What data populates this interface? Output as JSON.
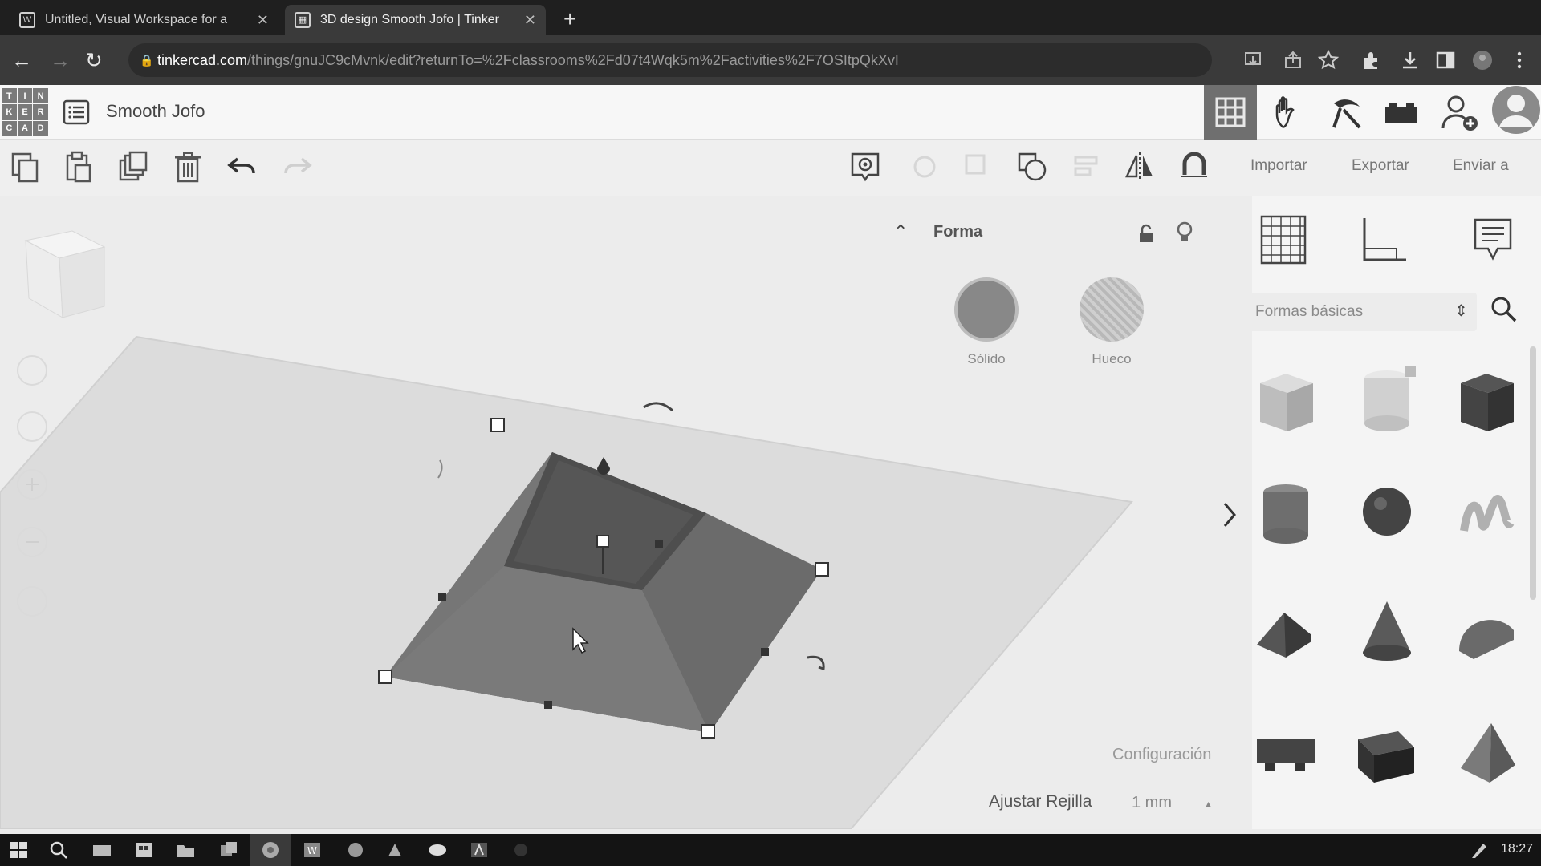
{
  "browser": {
    "tabs": [
      {
        "title": "Untitled, Visual Workspace for a",
        "active": false
      },
      {
        "title": "3D design Smooth Jofo | Tinker",
        "active": true
      }
    ],
    "url_host": "tinkercad.com",
    "url_path": "/things/gnuJC9cMvnk/edit?returnTo=%2Fclassrooms%2Fd07t4Wqk5m%2Factivities%2F7OSItpQkXvI"
  },
  "app": {
    "logo_letters": [
      "T",
      "I",
      "N",
      "K",
      "E",
      "R",
      "C",
      "A",
      "D"
    ],
    "design_name": "Smooth Jofo"
  },
  "toolbar": {
    "import_label": "Importar",
    "export_label": "Exportar",
    "send_label": "Enviar a"
  },
  "inspector": {
    "title": "Forma",
    "solid_label": "Sólido",
    "hole_label": "Hueco"
  },
  "shapes_panel": {
    "category": "Formas básicas"
  },
  "workplane": {
    "settings_label": "Configuración",
    "snap_label": "Ajustar Rejilla",
    "snap_value": "1 mm"
  },
  "taskbar": {
    "time": "18:27"
  },
  "colors": {
    "shape_main": "#6e6e6e",
    "workplane": "#dcdcdc",
    "tab_bar": "#1f1f1f"
  }
}
